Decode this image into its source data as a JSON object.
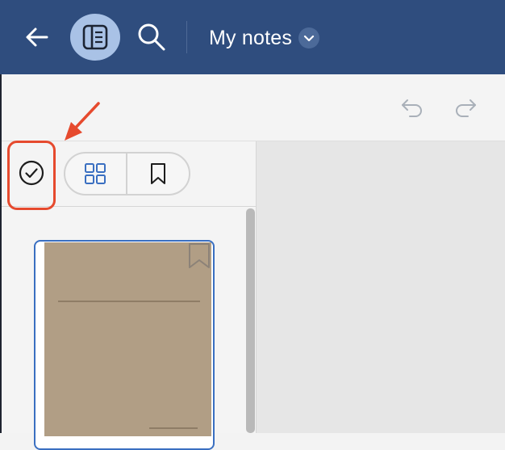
{
  "header": {
    "title": "My notes",
    "background": "#2f4d7e",
    "icons": {
      "back": "back-arrow-icon",
      "panel": "sidebar-panel-icon",
      "search": "search-icon",
      "dropdown": "chevron-down-icon"
    }
  },
  "toolbar": {
    "icons": {
      "undo": "undo-icon",
      "redo": "redo-icon"
    }
  },
  "sidebar": {
    "select_icon": "check-circle-icon",
    "view_toggle": {
      "grid_icon": "grid-icon",
      "bookmark_icon": "bookmark-icon"
    },
    "thumbnail": {
      "page_color": "#b19e85",
      "bookmark_icon": "bookmark-outline-icon"
    }
  },
  "annotation": {
    "highlight_color": "#e64a2e"
  }
}
